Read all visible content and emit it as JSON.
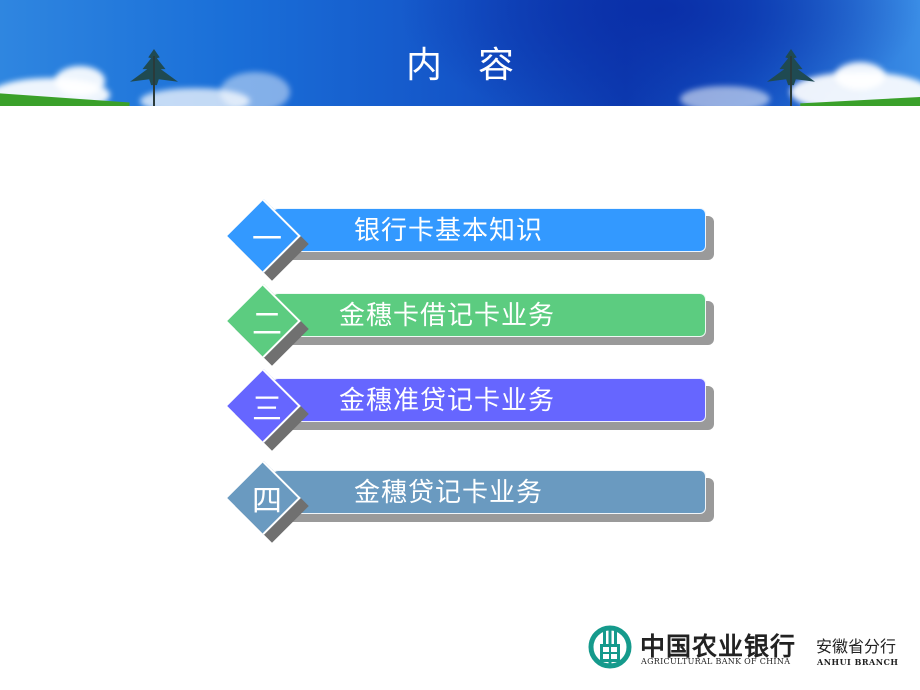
{
  "header": {
    "title_chars": [
      "内",
      "容"
    ]
  },
  "toc": {
    "items": [
      {
        "numeral": "一",
        "label": "银行卡基本知识",
        "color": "#3399ff"
      },
      {
        "numeral": "二",
        "label": "金穗卡借记卡业务",
        "color": "#5ccc80"
      },
      {
        "numeral": "三",
        "label": "金穗准贷记卡业务",
        "color": "#6666ff"
      },
      {
        "numeral": "四",
        "label": "金穗贷记卡业务",
        "color": "#6a9ac0"
      }
    ]
  },
  "footer": {
    "bank_name_cn": "中国农业银行",
    "bank_name_en": "AGRICULTURAL BANK OF CHINA",
    "branch_cn": "安徽省分行",
    "branch_en": "ANHUI  BRANCH",
    "brand_color": "#159a8c"
  }
}
